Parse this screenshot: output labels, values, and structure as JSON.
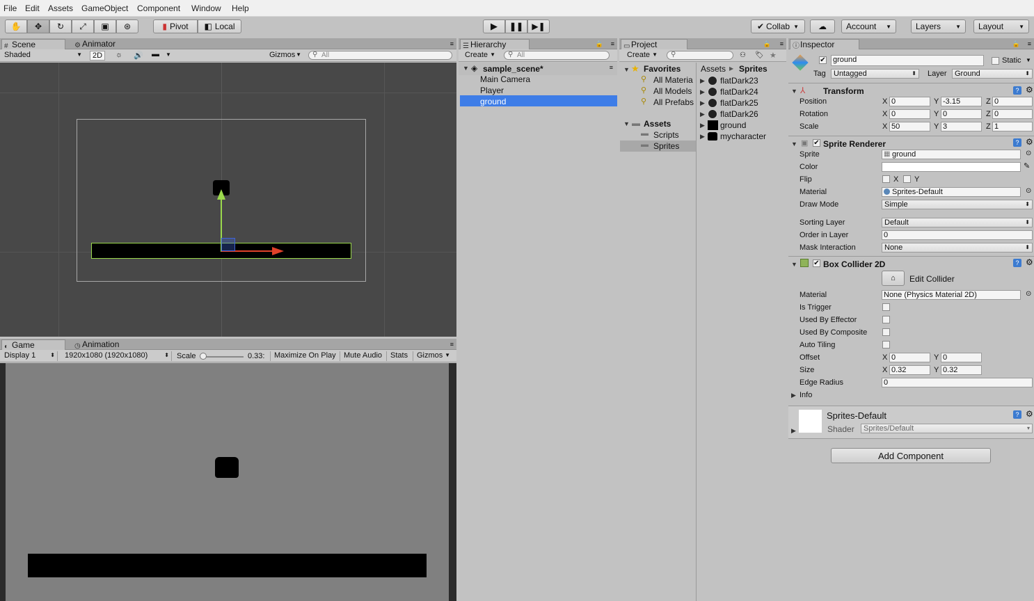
{
  "menu": [
    "File",
    "Edit",
    "Assets",
    "GameObject",
    "Component",
    "Window",
    "Help"
  ],
  "toolbar": {
    "pivot": "Pivot",
    "local": "Local",
    "collab": "Collab",
    "account": "Account",
    "layers": "Layers",
    "layout": "Layout"
  },
  "scene": {
    "tab_scene": "Scene",
    "tab_animator": "Animator",
    "shading": "Shaded",
    "mode2d": "2D",
    "gizmos": "Gizmos",
    "search_placeholder": "All"
  },
  "game": {
    "tab_game": "Game",
    "tab_animation": "Animation",
    "display": "Display 1",
    "resolution": "1920x1080 (1920x1080)",
    "scale_label": "Scale",
    "scale_value": "0.33:",
    "maximize": "Maximize On Play",
    "mute": "Mute Audio",
    "stats": "Stats",
    "gizmos": "Gizmos"
  },
  "hierarchy": {
    "tab": "Hierarchy",
    "create": "Create",
    "search_placeholder": "All",
    "scene_name": "sample_scene*",
    "items": [
      "Main Camera",
      "Player",
      "ground"
    ],
    "selected": "ground"
  },
  "project": {
    "tab": "Project",
    "create": "Create",
    "favorites_label": "Favorites",
    "favorites": [
      "All Materia",
      "All Models",
      "All Prefabs"
    ],
    "assets_label": "Assets",
    "folders": [
      "Scripts",
      "Sprites"
    ],
    "breadcrumb": [
      "Assets",
      "Sprites"
    ],
    "files": [
      "flatDark23",
      "flatDark24",
      "flatDark25",
      "flatDark26",
      "ground",
      "mycharacter"
    ]
  },
  "inspector": {
    "tab": "Inspector",
    "object_name": "ground",
    "static_label": "Static",
    "tag_label": "Tag",
    "tag_value": "Untagged",
    "layer_label": "Layer",
    "layer_value": "Ground",
    "transform": {
      "title": "Transform",
      "position_label": "Position",
      "rotation_label": "Rotation",
      "scale_label": "Scale",
      "position": [
        "0",
        "-3.15",
        "0"
      ],
      "rotation": [
        "0",
        "0",
        "0"
      ],
      "scale": [
        "50",
        "3",
        "1"
      ]
    },
    "sprite_renderer": {
      "title": "Sprite Renderer",
      "sprite_label": "Sprite",
      "sprite_value": "ground",
      "color_label": "Color",
      "flip_label": "Flip",
      "flip_x": "X",
      "flip_y": "Y",
      "material_label": "Material",
      "material_value": "Sprites-Default",
      "draw_mode_label": "Draw Mode",
      "draw_mode_value": "Simple",
      "sorting_layer_label": "Sorting Layer",
      "sorting_layer_value": "Default",
      "order_label": "Order in Layer",
      "order_value": "0",
      "mask_label": "Mask Interaction",
      "mask_value": "None"
    },
    "box_collider": {
      "title": "Box Collider 2D",
      "edit_collider": "Edit Collider",
      "material_label": "Material",
      "material_value": "None (Physics Material 2D)",
      "is_trigger": "Is Trigger",
      "used_by_effector": "Used By Effector",
      "used_by_composite": "Used By Composite",
      "auto_tiling": "Auto Tiling",
      "offset_label": "Offset",
      "offset": [
        "0",
        "0"
      ],
      "size_label": "Size",
      "size": [
        "0.32",
        "0.32"
      ],
      "edge_radius_label": "Edge Radius",
      "edge_radius_value": "0",
      "info_label": "Info"
    },
    "material": {
      "name": "Sprites-Default",
      "shader_label": "Shader",
      "shader_value": "Sprites/Default"
    },
    "add_component": "Add Component"
  },
  "axis": {
    "x": "X",
    "y": "Y",
    "z": "Z"
  },
  "colors": {
    "selection": "#3e7de7",
    "scene_bg": "#484848",
    "game_bg": "#808080",
    "gizmo_green": "#9bd94c",
    "gizmo_red": "#e0412a"
  }
}
